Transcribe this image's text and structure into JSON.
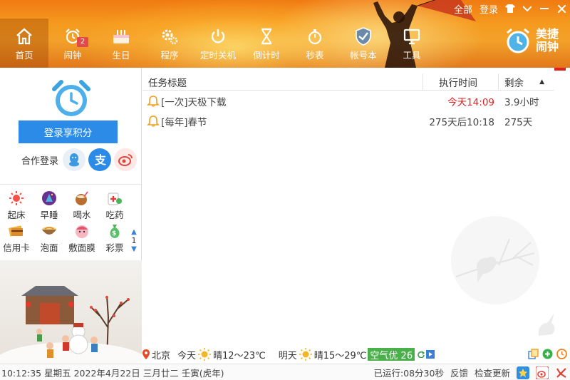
{
  "window_controls": {
    "all": "全部",
    "login": "登录"
  },
  "nav": [
    {
      "label": "首页",
      "icon": "home-icon"
    },
    {
      "label": "闹钟",
      "icon": "alarm-clock-icon",
      "badge": "2"
    },
    {
      "label": "生日",
      "icon": "cake-icon"
    },
    {
      "label": "程序",
      "icon": "gears-icon"
    },
    {
      "label": "定时关机",
      "icon": "power-icon"
    },
    {
      "label": "倒计时",
      "icon": "hourglass-icon"
    },
    {
      "label": "秒表",
      "icon": "stopwatch-icon"
    },
    {
      "label": "帐号本",
      "icon": "shield-icon"
    },
    {
      "label": "工具",
      "icon": "monitor-icon"
    }
  ],
  "brand": {
    "line1": "美捷",
    "line2": "闹钟"
  },
  "left": {
    "login_button": "登录享积分",
    "coop_label": "合作登录",
    "quick_items": [
      [
        {
          "label": "起床",
          "icon": "sun-icon"
        },
        {
          "label": "早睡",
          "icon": "moon-icon"
        },
        {
          "label": "喝水",
          "icon": "coconut-icon"
        },
        {
          "label": "吃药",
          "icon": "medicine-icon"
        }
      ],
      [
        {
          "label": "信用卡",
          "icon": "credit-card-icon"
        },
        {
          "label": "泡面",
          "icon": "noodle-bowl-icon"
        },
        {
          "label": "敷面膜",
          "icon": "face-mask-icon"
        },
        {
          "label": "彩票",
          "icon": "money-bag-icon"
        }
      ]
    ],
    "pager": "1"
  },
  "table": {
    "headers": {
      "title": "任务标题",
      "time": "执行时间",
      "remain": "剩余"
    },
    "rows": [
      {
        "title": "[一次]天极下载",
        "time": "今天14:09",
        "remain": "3.9小时",
        "time_highlight": true
      },
      {
        "title": "[每年]春节",
        "time": "275天后10:18",
        "remain": "275天",
        "time_highlight": false
      }
    ]
  },
  "weather": {
    "city": "北京",
    "today_label": "今天",
    "today": "晴12～23℃",
    "tomorrow_label": "明天",
    "tomorrow": "晴15～29℃",
    "air": "空气优 26"
  },
  "status": {
    "datetime": "10:12:35 星期五 2022年4月22日 三月廿二 壬寅(虎年)",
    "running": "已运行:08分30秒",
    "feedback": "反馈",
    "check_update": "检查更新"
  },
  "colors": {
    "accent_orange": "#f08a1a",
    "login_blue": "#2b8be6",
    "highlight_red": "#e02020",
    "air_green": "#4ab04a"
  }
}
